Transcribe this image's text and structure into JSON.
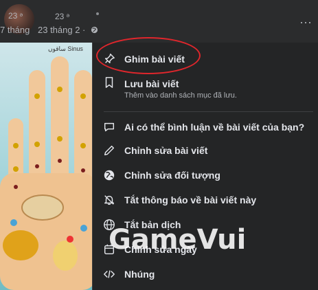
{
  "header": {
    "author_blur_a": "23 ᵊ",
    "author_blur_b": "23 ᵊ",
    "date_left": "7 tháng",
    "date_right": "23 tháng 2 ·",
    "more_icon": "more-horizontal-icon"
  },
  "photo": {
    "caption": "ساقوں Sinus"
  },
  "menu": {
    "items": [
      {
        "icon": "pin-icon",
        "label": "Ghim bài viết"
      },
      {
        "icon": "bookmark-icon",
        "label": "Lưu bài viết",
        "sub": "Thêm vào danh sách mục đã lưu."
      },
      {
        "icon": "comment-icon",
        "label": "Ai có thể bình luận về bài viết của bạn?"
      },
      {
        "icon": "pencil-icon",
        "label": "Chỉnh sửa bài viết"
      },
      {
        "icon": "globe-icon",
        "label": "Chỉnh sửa đối tượng"
      },
      {
        "icon": "bell-off-icon",
        "label": "Tắt thông báo về bài viết này"
      },
      {
        "icon": "translate-globe-icon",
        "label": "Tắt bản dịch"
      },
      {
        "icon": "calendar-icon",
        "label": "Chỉnh sửa ngày"
      },
      {
        "icon": "code-icon",
        "label": "Nhúng"
      }
    ]
  },
  "watermark": "GameVui",
  "colors": {
    "menu_bg": "#242526",
    "text": "#e4e6eb",
    "highlight": "#e0262c"
  }
}
